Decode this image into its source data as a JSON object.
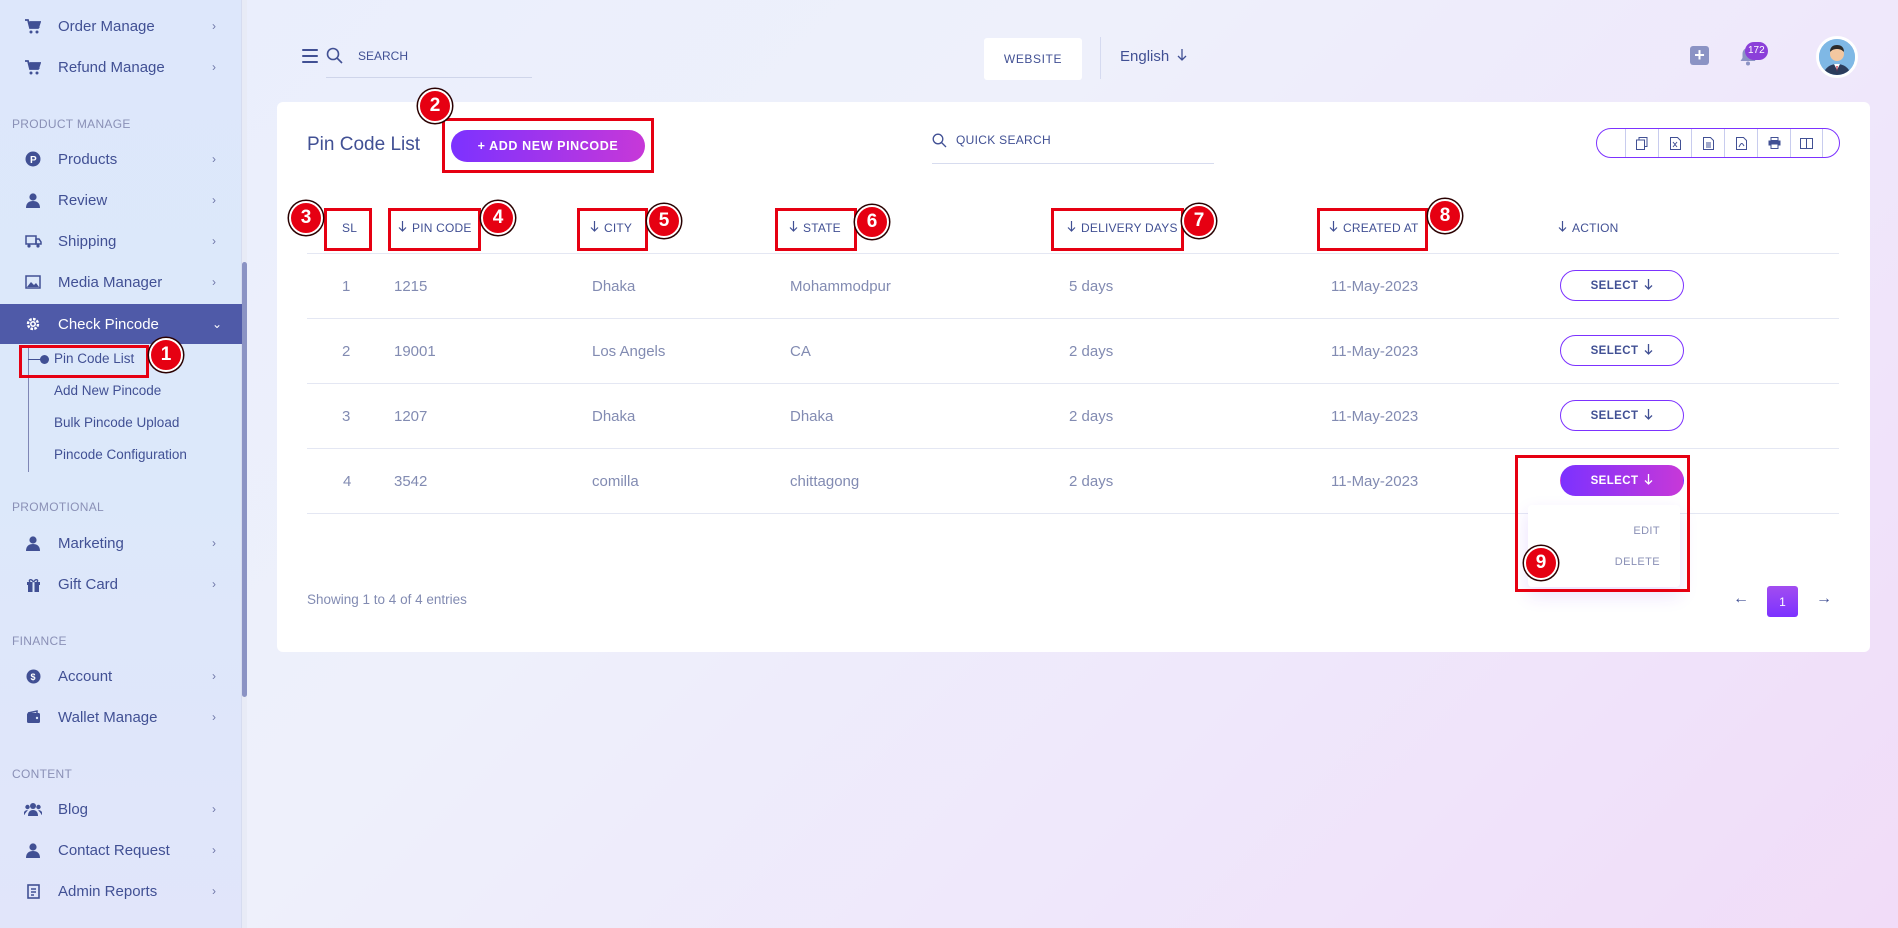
{
  "sidebar": {
    "items_top": [
      {
        "label": "Order Manage",
        "icon": "cart-icon"
      },
      {
        "label": "Refund Manage",
        "icon": "cart-icon"
      }
    ],
    "section_product": "PRODUCT MANAGE",
    "product_items": [
      {
        "label": "Products",
        "icon": "product-p-icon"
      },
      {
        "label": "Review",
        "icon": "user-icon"
      },
      {
        "label": "Shipping",
        "icon": "shipping-icon"
      },
      {
        "label": "Media Manager",
        "icon": "image-icon"
      },
      {
        "label": "Check Pincode",
        "icon": "gear-icon"
      }
    ],
    "pincode_sub": [
      "Pin Code List",
      "Add New Pincode",
      "Bulk Pincode Upload",
      "Pincode Configuration"
    ],
    "section_promotional": "PROMOTIONAL",
    "promo_items": [
      {
        "label": "Marketing",
        "icon": "user-icon"
      },
      {
        "label": "Gift Card",
        "icon": "gift-icon"
      }
    ],
    "section_finance": "FINANCE",
    "finance_items": [
      {
        "label": "Account",
        "icon": "coin-icon"
      },
      {
        "label": "Wallet Manage",
        "icon": "wallet-icon"
      }
    ],
    "section_content": "CONTENT",
    "content_items": [
      {
        "label": "Blog",
        "icon": "users-icon"
      },
      {
        "label": "Contact Request",
        "icon": "user-icon"
      },
      {
        "label": "Admin Reports",
        "icon": "report-icon"
      }
    ]
  },
  "header": {
    "search_placeholder": "SEARCH",
    "website_label": "WEBSITE",
    "language": "English",
    "notification_count": "172"
  },
  "page": {
    "title": "Pin Code List",
    "add_button": "+ ADD NEW PINCODE",
    "quick_search_placeholder": "QUICK SEARCH"
  },
  "table": {
    "columns": [
      "SL",
      "PIN CODE",
      "CITY",
      "STATE",
      "DELIVERY DAYS",
      "CREATED AT",
      "ACTION"
    ],
    "rows": [
      {
        "sl": "1",
        "pin": "1215",
        "city": "Dhaka",
        "state": "Mohammodpur",
        "days": "5 days",
        "created": "11-May-2023",
        "action": "SELECT"
      },
      {
        "sl": "2",
        "pin": "19001",
        "city": "Los Angels",
        "state": "CA",
        "days": "2 days",
        "created": "11-May-2023",
        "action": "SELECT"
      },
      {
        "sl": "3",
        "pin": "1207",
        "city": "Dhaka",
        "state": "Dhaka",
        "days": "2 days",
        "created": "11-May-2023",
        "action": "SELECT"
      },
      {
        "sl": "4",
        "pin": "3542",
        "city": "comilla",
        "state": "chittagong",
        "days": "2 days",
        "created": "11-May-2023",
        "action": "SELECT"
      }
    ],
    "dropdown": [
      "EDIT",
      "DELETE"
    ],
    "footer_info": "Showing 1 to 4 of 4 entries",
    "current_page": "1"
  },
  "annotations": [
    "1",
    "2",
    "3",
    "4",
    "5",
    "6",
    "7",
    "8",
    "9"
  ],
  "colors": {
    "accent_start": "#7c32ff",
    "accent_end": "#c738d8",
    "text": "#415094",
    "sidebar_active": "#4f5aa8",
    "annotation_red": "#e60012"
  }
}
